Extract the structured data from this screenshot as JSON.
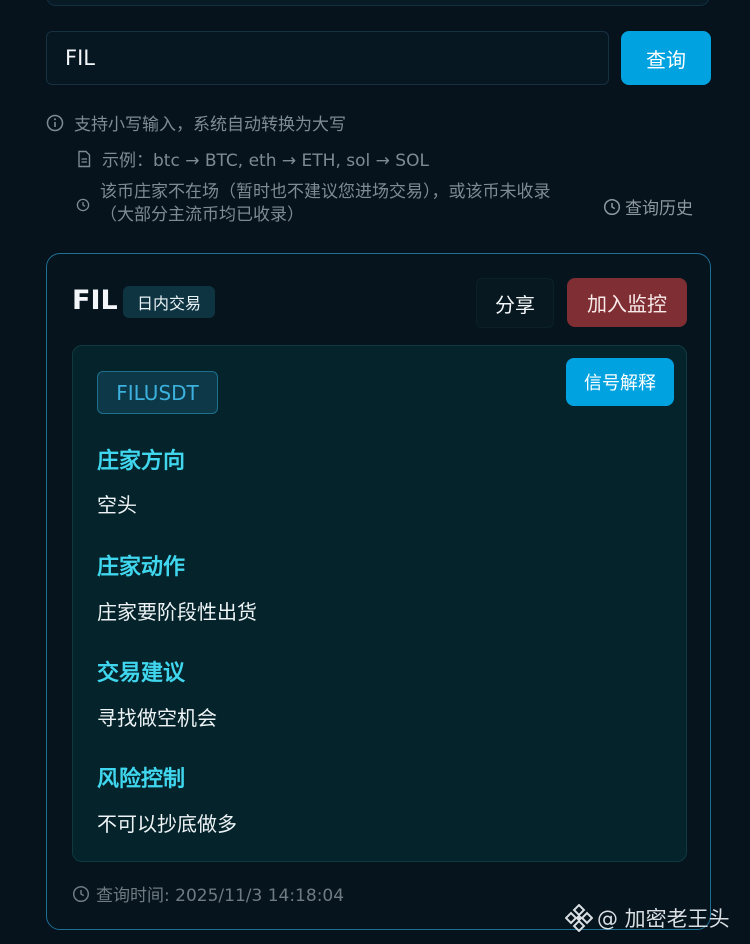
{
  "search": {
    "value": "FIL",
    "button_label": "查询"
  },
  "hints": {
    "lowercase": "支持小写输入，系统自动转换为大写",
    "example": "示例：btc → BTC, eth → ETH, sol → SOL",
    "not_listed_line1": "该币庄家不在场（暂时也不建议您进场交易），或该币未收录",
    "not_listed_line2": "（大部分主流币均已收录）",
    "history_label": "查询历史"
  },
  "result": {
    "coin": "FIL",
    "mode_badge": "日内交易",
    "share_label": "分享",
    "monitor_label": "加入监控",
    "pair": "FILUSDT",
    "explain_label": "信号解释",
    "sections": [
      {
        "title": "庄家方向",
        "value": "空头"
      },
      {
        "title": "庄家动作",
        "value": "庄家要阶段性出货"
      },
      {
        "title": "交易建议",
        "value": "寻找做空机会"
      },
      {
        "title": "风险控制",
        "value": "不可以抄底做多"
      }
    ],
    "query_time": "查询时间: 2025/11/3 14:18:04"
  },
  "watermark": "@ 加密老王头",
  "colors": {
    "accent": "#00a3e0",
    "danger": "#7f2e33",
    "heading": "#3fd6ee"
  },
  "icons": [
    "info-icon",
    "document-icon",
    "clock-icon",
    "binance-logo-icon"
  ]
}
